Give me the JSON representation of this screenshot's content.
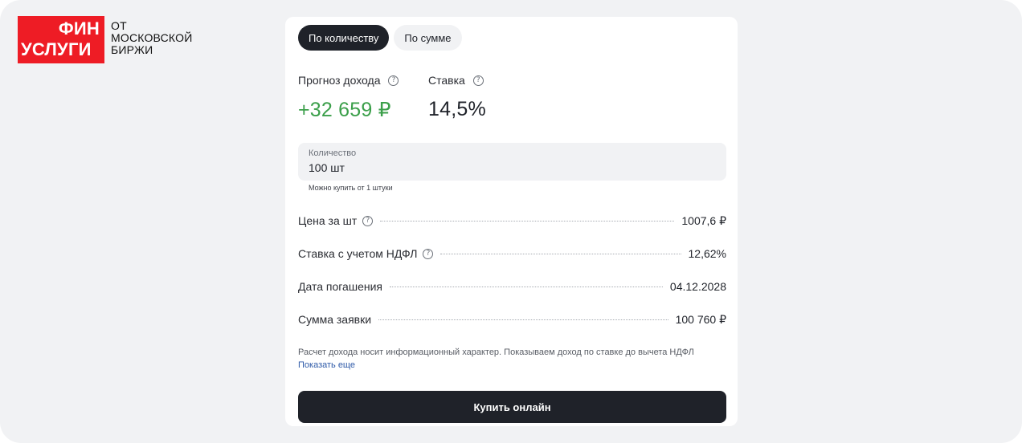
{
  "logo": {
    "line1": "ФИН",
    "line2": "УСЛУГИ",
    "caption": [
      "ОТ",
      "МОСКОВСКОЙ",
      "БИРЖИ"
    ],
    "brand_color": "#ee1c25"
  },
  "tabs": [
    {
      "label": "По количеству",
      "active": true
    },
    {
      "label": "По сумме",
      "active": false
    }
  ],
  "metrics": {
    "income_label": "Прогноз дохода",
    "income_value": "+32 659 ₽",
    "rate_label": "Ставка",
    "rate_value": "14,5%",
    "help_icon_glyph": "?",
    "income_color": "#3b9f4a"
  },
  "quantity": {
    "label": "Количество",
    "value": "100 шт",
    "hint": "Можно купить от 1 штуки"
  },
  "details": [
    {
      "label": "Цена за шт",
      "value": "1007,6 ₽",
      "help": true
    },
    {
      "label": "Ставка с учетом НДФЛ",
      "value": "12,62%",
      "help": true
    },
    {
      "label": "Дата погашения",
      "value": "04.12.2028",
      "help": false
    },
    {
      "label": "Сумма заявки",
      "value": "100 760 ₽",
      "help": false
    }
  ],
  "disclaimer": {
    "text": "Расчет дохода носит информационный характер. Показываем доход по ставке до вычета НДФЛ",
    "show_more": "Показать еще"
  },
  "buy_button": {
    "label": "Купить онлайн"
  },
  "colors": {
    "accent_dark": "#1f2229",
    "background": "#f1f2f4",
    "link": "#2e5aa8"
  }
}
